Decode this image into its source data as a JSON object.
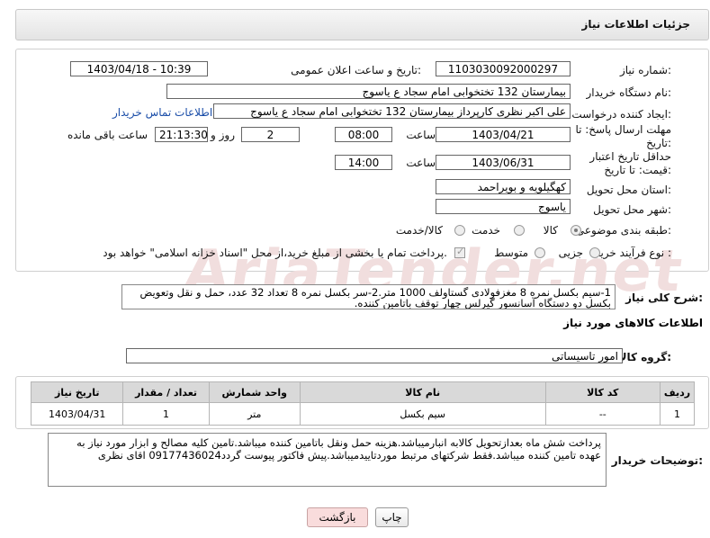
{
  "page": {
    "title": "جزئیات اطلاعات نیاز"
  },
  "fields": {
    "need_number": {
      "label": "شماره نیاز:",
      "value": "1103030092000297"
    },
    "announce_datetime": {
      "label": "تاریخ و ساعت اعلان عمومی:",
      "value": "1403/04/18 - 10:39"
    },
    "buyer_org": {
      "label": "نام دستگاه خریدار:",
      "value": "بیمارستان 132 تختخوابی امام سجاد  ع  یاسوج"
    },
    "requester": {
      "label": "ایجاد کننده درخواست:",
      "value": "علی اکبر نظری  کارپرداز بیمارستان 132 تختخوابی امام سجاد  ع  یاسوج",
      "contact_link": "اطلاعات تماس خریدار"
    },
    "reply_deadline": {
      "label": "مهلت ارسال پاسخ: تا تاریخ:",
      "date": "1403/04/21",
      "time_label": "ساعت",
      "time": "08:00",
      "days": "2",
      "days_label": "روز و",
      "remaining": "21:13:30",
      "remaining_label": "ساعت باقی مانده"
    },
    "price_validity": {
      "label": "حداقل تاریخ اعتبار قیمت: تا تاریخ:",
      "date": "1403/06/31",
      "time_label": "ساعت",
      "time": "14:00"
    },
    "province": {
      "label": "استان محل تحویل:",
      "value": "کهگیلویه و بویراحمد"
    },
    "city": {
      "label": "شهر محل تحویل:",
      "value": "یاسوج"
    },
    "category": {
      "label": "طبقه بندی موضوعی:",
      "options": [
        "کالا",
        "خدمت",
        "کالا/خدمت"
      ],
      "selected": "کالا"
    },
    "purchase_type": {
      "label": "نوع فرآیند خرید :",
      "options": [
        "جزیی",
        "متوسط"
      ],
      "selected": "جزیی",
      "payment_note": "پرداخت تمام یا بخشی از مبلغ خرید،از محل \"اسناد خزانه اسلامی\" خواهد بود."
    }
  },
  "need_description": {
    "label": "شرح کلی نیاز:",
    "text": "1-سیم بکسل نمره 8 مغزفولادی گستاولف 1000 متر.2-سر بکسل نمره 8 تعداد 32 عدد، حمل و نقل وتعویض بکسل دو دستگاه آسانسور گیرلس چهار توقف باتامین کننده."
  },
  "goods_section": {
    "title": "اطلاعات کالاهای مورد نیاز",
    "group_label": "گروه کالا:",
    "group_value": "امور تاسیساتی",
    "table": {
      "headers": [
        "ردیف",
        "کد کالا",
        "نام کالا",
        "واحد شمارش",
        "تعداد / مقدار",
        "تاریخ نیاز"
      ],
      "rows": [
        [
          "1",
          "--",
          "سیم بکسل",
          "متر",
          "1",
          "1403/04/31"
        ]
      ]
    }
  },
  "buyer_notes": {
    "label": "توضیحات خریدار:",
    "text": "پرداخت شش ماه بعدازتحویل کالابه انبارمیباشد.هزینه حمل ونقل باتامین کننده میباشد.تامین کلیه مصالح و ابزار مورد نیاز به عهده تامین کننده میباشد.فقط شرکتهای مرتبط موردتاییدمیباشد.پیش فاکتور پیوست گردد09177436024  اقای نظری"
  },
  "buttons": {
    "print": "چاپ",
    "back": "بازگشت"
  },
  "watermark": "AriaTender.net",
  "colors": {
    "header_bg": "#e4e4e4",
    "link": "#1a4da8",
    "back_button": "#f9dcdc",
    "table_header": "#d9d9d9"
  }
}
